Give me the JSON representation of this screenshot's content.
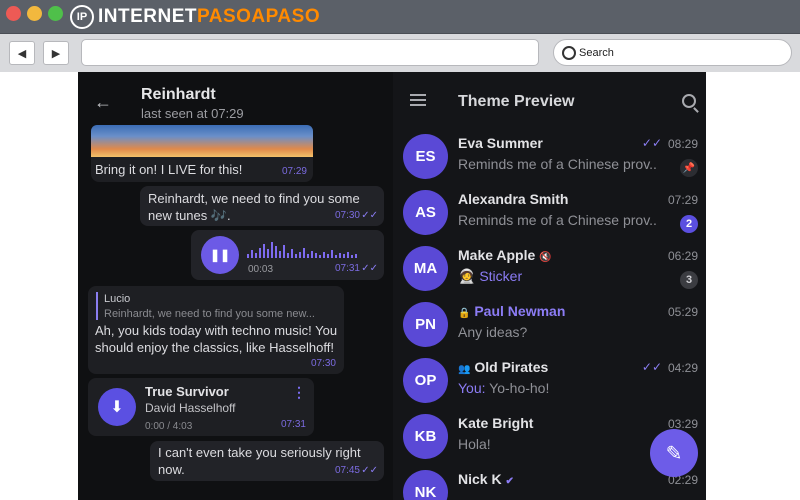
{
  "window": {
    "logo_a": "INTERNET",
    "logo_b": "PASOAPASO",
    "logo_mark": "IP"
  },
  "browser": {
    "back_glyph": "◀",
    "forward_glyph": "▶",
    "search_placeholder": "Search"
  },
  "chat": {
    "name": "Reinhardt",
    "status": "last seen at 07:29",
    "messages": [
      {
        "text": "Bring it on! I LIVE for this!",
        "time": "07:29"
      },
      {
        "text": "Reinhardt, we need to find you some new tunes 🎶.",
        "time": "07:30"
      },
      {
        "voice_duration": "00:03",
        "time": "07:31"
      },
      {
        "reply_author": "Lucio",
        "reply_text": "Reinhardt, we need to find you some new...",
        "text": "Ah, you kids today with techno music! You should enjoy the classics, like Hasselhoff!",
        "time": "07:30"
      },
      {
        "title": "True Survivor",
        "artist": "David Hasselhoff",
        "progress": "0:00 / 4:03",
        "time": "07:31"
      },
      {
        "text": "I can't even take you seriously right now.",
        "time": "07:45"
      }
    ]
  },
  "list": {
    "title": "Theme Preview",
    "chats": [
      {
        "initials": "ES",
        "name": "Eva Summer",
        "message": "Reminds me of a Chinese prov...",
        "time": "08:29",
        "read": true,
        "pinned": true
      },
      {
        "initials": "AS",
        "name": "Alexandra Smith",
        "message": "Reminds me of a Chinese prov...",
        "time": "07:29",
        "badge": "2"
      },
      {
        "initials": "MA",
        "name": "Make Apple",
        "message": "🧑‍🚀 Sticker",
        "time": "06:29",
        "badge": "3",
        "muted": true
      },
      {
        "initials": "PN",
        "name": "Paul Newman",
        "message": "Any ideas?",
        "time": "05:29",
        "locked": true
      },
      {
        "initials": "OP",
        "name": "Old Pirates",
        "sender": "You:",
        "message": "Yo-ho-ho!",
        "time": "04:29",
        "read": true,
        "group": true
      },
      {
        "initials": "KB",
        "name": "Kate Bright",
        "message": "Hola!",
        "time": "03:29"
      },
      {
        "initials": "NK",
        "name": "Nick K",
        "message": "",
        "time": "02:29",
        "verified": true
      }
    ]
  },
  "icons": {
    "back": "arrow-left-icon",
    "menu": "hamburger-menu-icon",
    "search": "search-icon",
    "compose": "pencil-icon",
    "pin": "pin-icon",
    "mute": "muted-speaker-icon",
    "lock": "lock-icon",
    "group": "group-icon",
    "verified": "verified-badge-icon",
    "pause": "pause-icon",
    "download": "download-arrow-icon",
    "more": "kebab-menu-icon"
  },
  "glyphs": {
    "back": "←",
    "pause": "❚❚",
    "download": "⬇",
    "more": "⋮",
    "ticks": "✓✓",
    "pin": "📌",
    "mute": "🔇",
    "lock": "🔒",
    "group": "👥",
    "verified": "✔",
    "compose": "✎"
  },
  "colors": {
    "accent": "#6c5ae6",
    "background": "#111214",
    "list_background": "#141518"
  }
}
